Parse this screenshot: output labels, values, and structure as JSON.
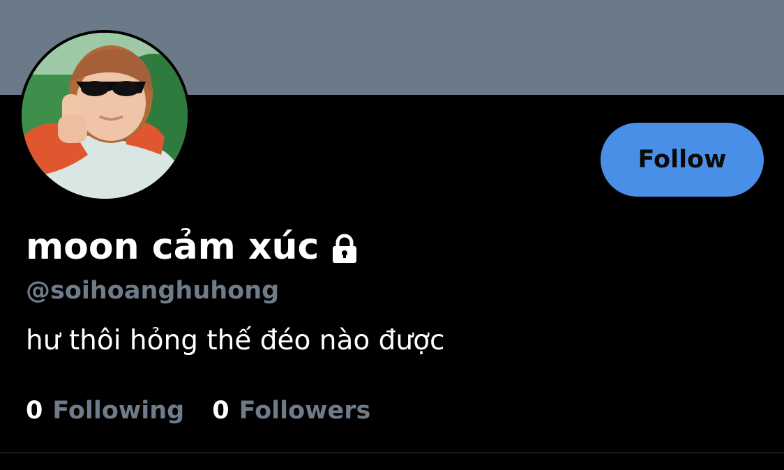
{
  "profile": {
    "display_name": "moon cảm xúc",
    "handle": "@soihoanghuhong",
    "bio": "hư thôi hỏng thế đéo nào được",
    "protected_icon": "lock-icon"
  },
  "actions": {
    "follow_label": "Follow"
  },
  "stats": {
    "following_count": "0",
    "following_label": "Following",
    "followers_count": "0",
    "followers_label": "Followers"
  },
  "colors": {
    "banner": "#6b7a89",
    "background": "#000000",
    "follow_button": "#4a8fe7",
    "muted_text": "#6e7b89"
  }
}
